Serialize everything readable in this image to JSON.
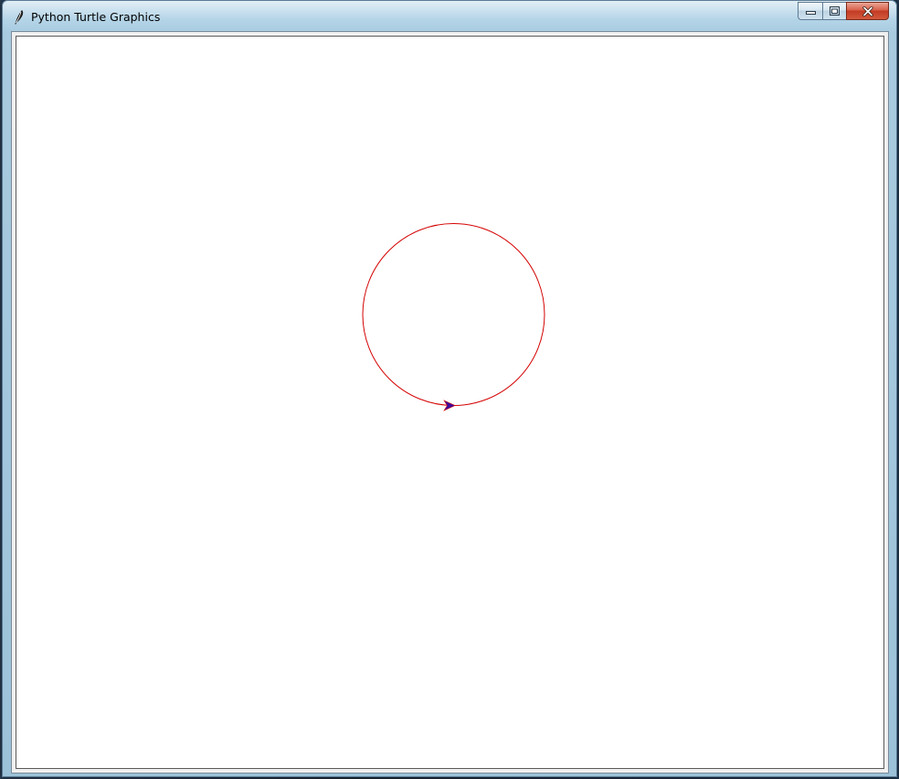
{
  "window": {
    "title": "Python Turtle Graphics",
    "icon": "feather-icon",
    "caption_buttons": [
      {
        "name": "minimize-button",
        "icon": "minimize-icon"
      },
      {
        "name": "maximize-button",
        "icon": "maximize-icon"
      },
      {
        "name": "close-button",
        "icon": "close-icon"
      }
    ]
  },
  "canvas": {
    "background": "#ffffff",
    "drawing": {
      "shape": "circle",
      "pen_color": "#d40000",
      "turtle_color": "#3a0aa0",
      "turtle_icon": "arrow-cursor-icon"
    }
  }
}
